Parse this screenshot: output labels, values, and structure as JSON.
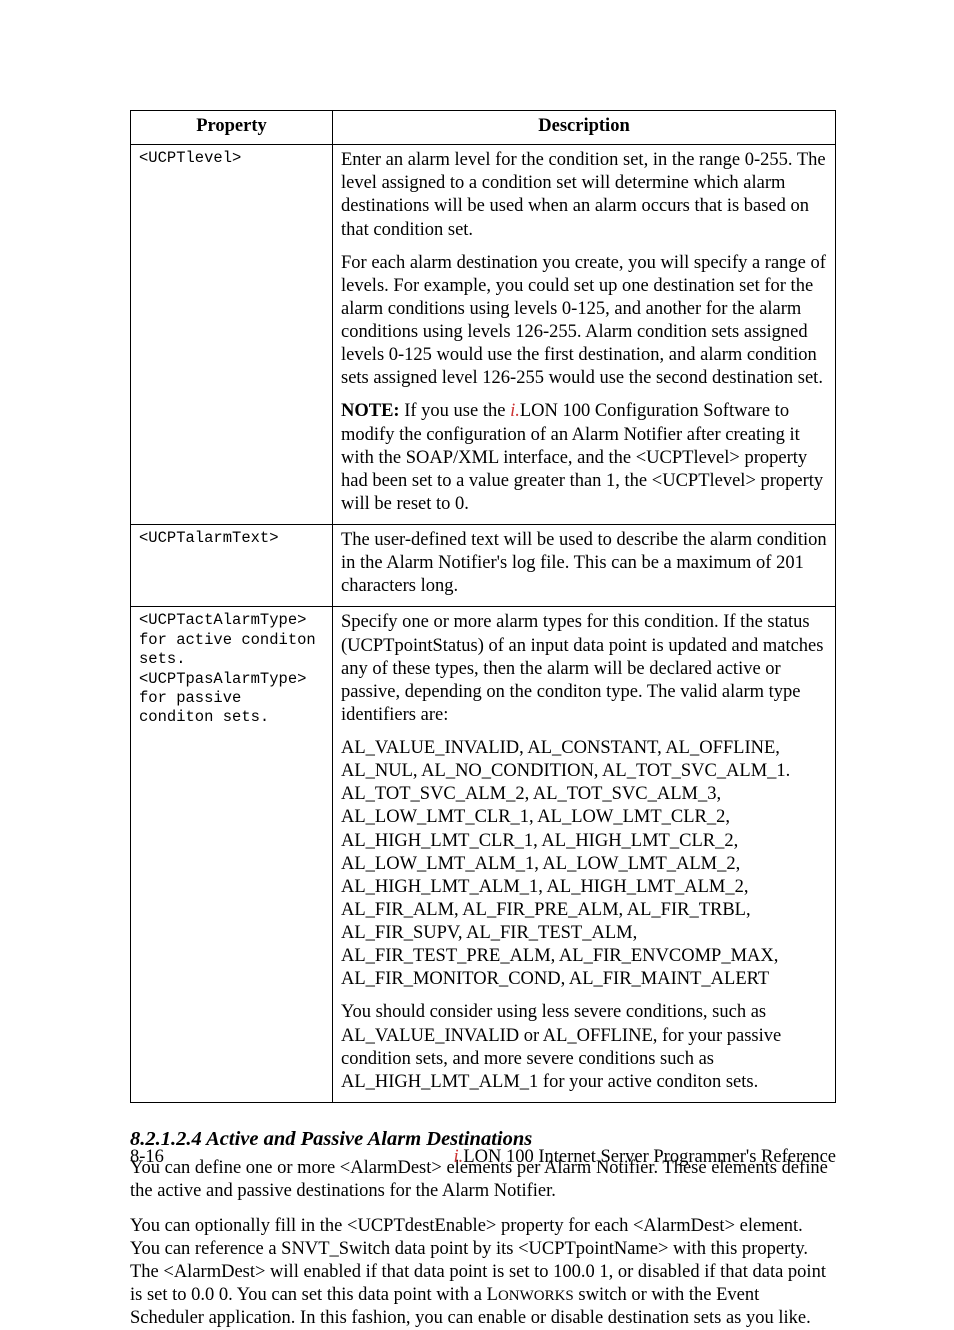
{
  "table": {
    "head_property": "Property",
    "head_description": "Description",
    "rows": [
      {
        "prop": "<UCPTlevel>",
        "p1": "Enter an alarm level for the condition set, in the range 0-255. The level assigned to a condition set will determine which alarm destinations will be used when an alarm occurs that is  based on that condition set.",
        "p2": "For each alarm destination you create, you will specify a range of levels. For example, you could set up one destination set for the alarm conditions using levels 0-125, and another for the alarm conditions using levels 126-255. Alarm condition sets assigned levels 0-125 would use the first destination, and alarm condition sets assigned level 126-255 would use the second destination set.",
        "note_label": "NOTE:",
        "note_pre": " If you use the ",
        "note_i": "i.",
        "note_post": "LON 100 Configuration Software to modify the configuration of an Alarm Notifier after creating it with the SOAP/XML interface, and the <UCPTlevel> property had been set to a value greater than 1, the <UCPTlevel> property will be reset to 0."
      },
      {
        "prop": "<UCPTalarmText>",
        "p1": "The user-defined text will be used to describe the alarm condition in the Alarm Notifier's log file. This can be a maximum of 201 characters long."
      },
      {
        "prop_l1": "<UCPTactAlarmType>",
        "prop_l2": "for active conditon sets.",
        "prop_l3": "<UCPTpasAlarmType>",
        "prop_l4": "for passive conditon sets.",
        "p1": "Specify one or more alarm types for this condition. If the status (UCPTpointStatus) of an input data point is updated and matches any of these types, then the alarm will be declared active or passive, depending on the conditon type. The valid alarm type identifiers are:",
        "p2": "AL_VALUE_INVALID, AL_CONSTANT, AL_OFFLINE, AL_NUL, AL_NO_CONDITION, AL_TOT_SVC_ALM_1. AL_TOT_SVC_ALM_2, AL_TOT_SVC_ALM_3, AL_LOW_LMT_CLR_1, AL_LOW_LMT_CLR_2, AL_HIGH_LMT_CLR_1, AL_HIGH_LMT_CLR_2, AL_LOW_LMT_ALM_1, AL_LOW_LMT_ALM_2, AL_HIGH_LMT_ALM_1, AL_HIGH_LMT_ALM_2, AL_FIR_ALM, AL_FIR_PRE_ALM, AL_FIR_TRBL, AL_FIR_SUPV, AL_FIR_TEST_ALM, AL_FIR_TEST_PRE_ALM, AL_FIR_ENVCOMP_MAX, AL_FIR_MONITOR_COND, AL_FIR_MAINT_ALERT",
        "p3": "You should consider using less severe conditions, such as AL_VALUE_INVALID or AL_OFFLINE, for your passive condition sets, and more severe conditions such as AL_HIGH_LMT_ALM_1 for your active conditon sets."
      }
    ]
  },
  "section": {
    "heading": "8.2.1.2.4  Active and Passive Alarm Destinations",
    "p1": "You can define one or more <AlarmDest> elements per Alarm Notifier. These elements define the active and passive destinations for the Alarm Notifier.",
    "p2_a": "You can optionally fill in the <UCPTdestEnable> property for each <AlarmDest> element. You can reference a SNVT_Switch data point by its <UCPTpointName> with this property. The <AlarmDest> will enabled if that data point is set to 100.0 1, or disabled if that data point is set to 0.0 0. You can set this data point with a L",
    "p2_sc": "ONWORKS",
    "p2_b": " switch or with the Event Scheduler application. In this fashion, you can enable or disable destination sets as you like."
  },
  "footer": {
    "page": "8-16",
    "i": "i.",
    "title": "LON 100 Internet Server Programmer's Reference"
  }
}
